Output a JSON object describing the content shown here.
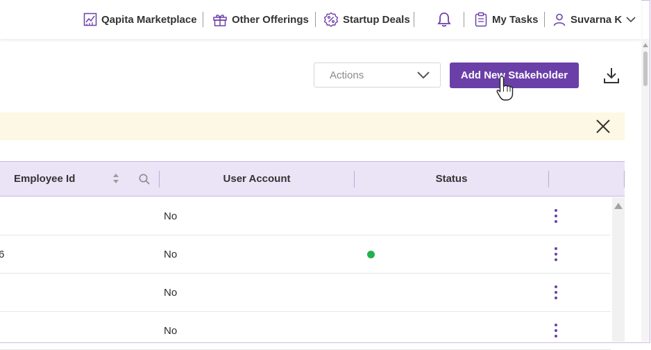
{
  "nav": {
    "marketplace": "Qapita Marketplace",
    "offerings": "Other Offerings",
    "deals": "Startup Deals",
    "tasks": "My Tasks",
    "user": "Suvarna K"
  },
  "toolbar": {
    "actions_label": "Actions",
    "add_label": "Add New Stakeholder"
  },
  "table": {
    "headers": {
      "employee_id": "Employee Id",
      "user_account": "User Account",
      "status": "Status"
    },
    "rows": [
      {
        "clipped": "",
        "user_account": "No",
        "status_active": false
      },
      {
        "clipped": "6",
        "user_account": "No",
        "status_active": true
      },
      {
        "clipped": "",
        "user_account": "No",
        "status_active": false
      },
      {
        "clipped": "",
        "user_account": "No",
        "status_active": false
      }
    ]
  },
  "colors": {
    "accent": "#6b3fa8",
    "header_bg": "#ebe3f6",
    "banner_bg": "#fdf8e3",
    "status_green": "#22b14c"
  },
  "icons": [
    "chart-icon",
    "gift-icon",
    "percent-badge-icon",
    "bell-icon",
    "clipboard-icon",
    "user-icon",
    "chevron-down-icon",
    "download-icon",
    "close-icon",
    "sort-icon",
    "search-icon",
    "kebab-menu-icon",
    "hand-cursor-icon"
  ]
}
